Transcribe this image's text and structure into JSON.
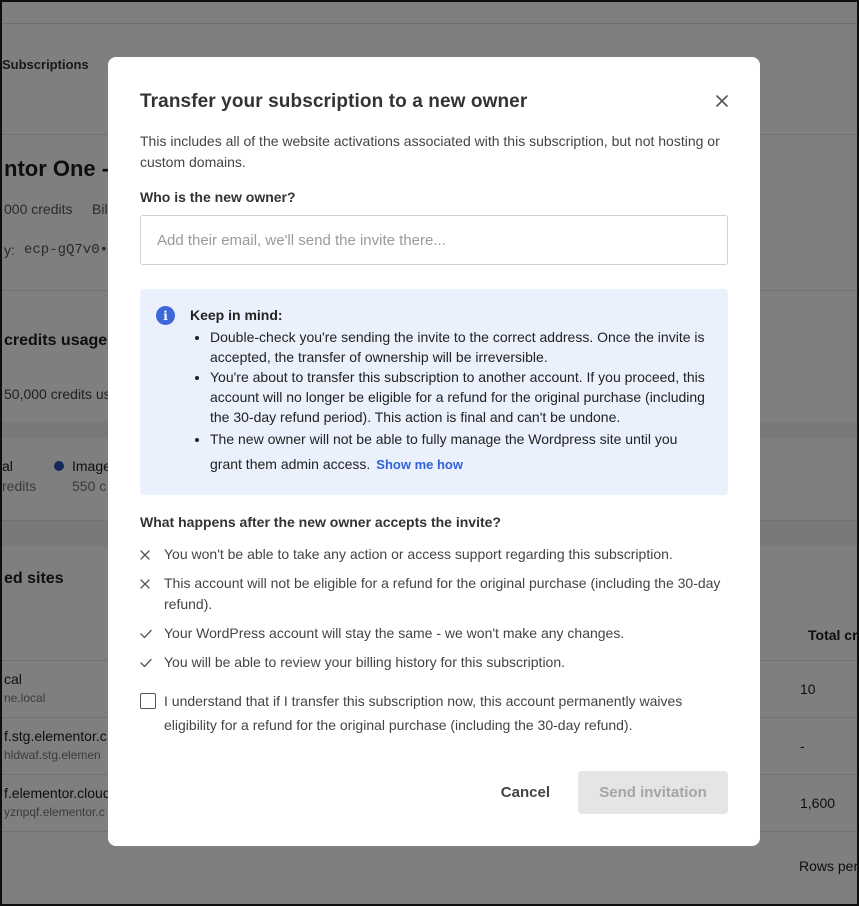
{
  "background": {
    "nav_label": "Subscriptions",
    "plan_title": "ntor One -",
    "credits_summary": "000 credits",
    "billing_label": "Bill",
    "key_label": "y:",
    "key_value": "ecp-gQ7v0••",
    "credits_usage_heading": "credits usage",
    "credits_used": "50,000 credits us",
    "legend": {
      "left_label": "al",
      "left_value": "redits",
      "image_label": "Image",
      "image_value": "550 c"
    },
    "sites_heading": "ed sites",
    "total_column": "Total cre",
    "rows": [
      {
        "name": "cal",
        "domain": "ne.local",
        "total": "10"
      },
      {
        "name": "f.stg.elementor.c",
        "domain": "hldwaf.stg.elemen",
        "total": "-"
      },
      {
        "name": "f.elementor.cloud",
        "domain": "yznpqf.elementor.c",
        "total": "1,600"
      }
    ],
    "rows_per_page": "Rows per"
  },
  "modal": {
    "title": "Transfer your subscription to a new owner",
    "intro": "This includes all of the website activations associated with this subscription, but not hosting or custom domains.",
    "field_label": "Who is the new owner?",
    "email_placeholder": "Add their email, we'll send the invite there...",
    "email_value": "",
    "info": {
      "title": "Keep in mind:",
      "items": [
        "Double-check you're sending the invite to the correct address. Once the invite is accepted, the transfer of ownership will be irreversible.",
        "You're about to transfer this subscription to another account. If you proceed, this account will no longer be eligible for a refund for the original purchase (including the 30-day refund period). This action is final and can't be undone.",
        "The new owner will not be able to fully manage the Wordpress site until you grant them admin access."
      ],
      "link_label": "Show me how"
    },
    "after_title": "What happens after the new owner accepts the invite?",
    "consequences": [
      {
        "icon": "x-icon",
        "text": "You won't be able to take any action or access support regarding this subscription."
      },
      {
        "icon": "x-icon",
        "text": "This account will not be eligible for a refund for the original purchase (including the 30-day refund)."
      },
      {
        "icon": "check-icon",
        "text": "Your WordPress account will stay the same - we won't make any changes."
      },
      {
        "icon": "check-icon",
        "text": "You will be able to review your billing history for this subscription."
      }
    ],
    "acknowledge": "I understand that if I transfer this subscription now, this account permanently waives eligibility for a refund for the original purchase (including the 30-day refund).",
    "acknowledge_checked": false,
    "cancel_label": "Cancel",
    "send_label": "Send invitation",
    "colors": {
      "accent": "#3d68d8",
      "link": "#2f63d6",
      "info_bg": "#ebf1fc",
      "disabled_bg": "#e5e5e5",
      "disabled_text": "#a5a5a5"
    }
  }
}
